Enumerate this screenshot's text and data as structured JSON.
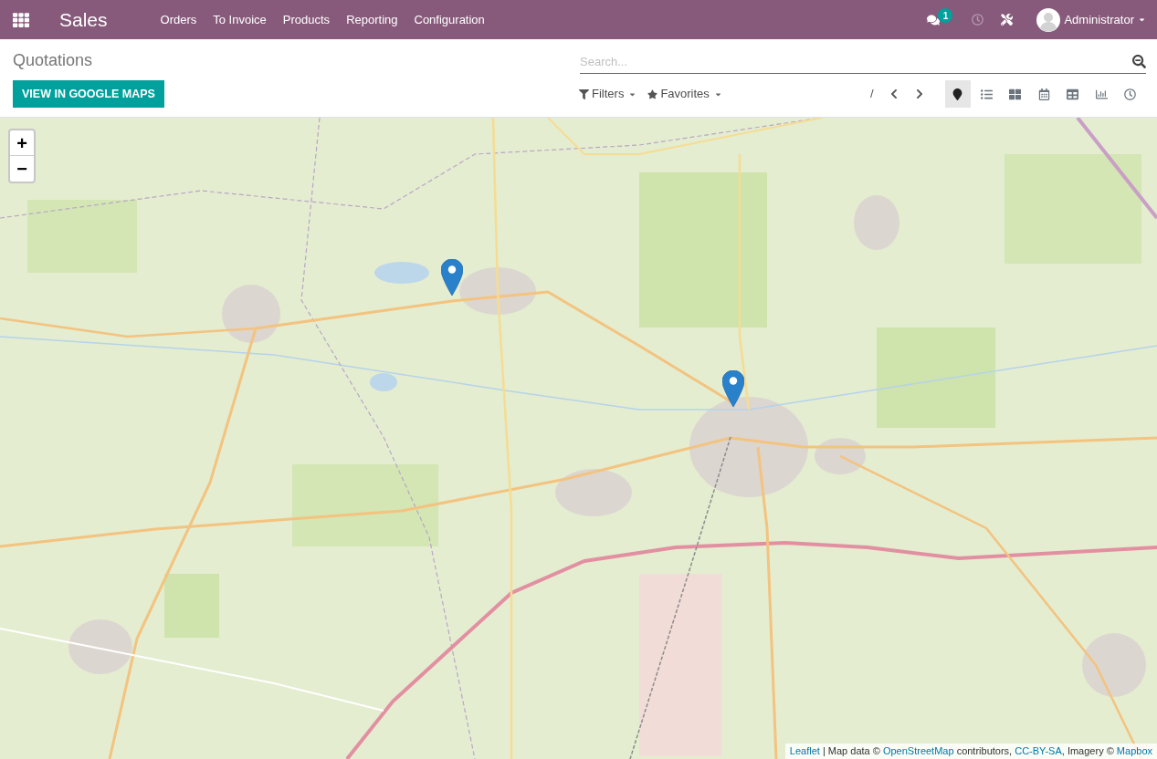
{
  "navbar": {
    "app_name": "Sales",
    "menu": [
      "Orders",
      "To Invoice",
      "Products",
      "Reporting",
      "Configuration"
    ],
    "messages_badge": "1",
    "user": "Administrator"
  },
  "control_panel": {
    "breadcrumb": "Quotations",
    "action_button": "VIEW IN GOOGLE MAPS",
    "search": {
      "placeholder": "Search..."
    },
    "filters": [
      {
        "kind": "filter",
        "label": "Filters"
      },
      {
        "kind": "favorites",
        "label": "Favorites"
      }
    ],
    "pager": "/",
    "views": [
      {
        "kind": "map",
        "selected": true
      },
      {
        "kind": "list",
        "selected": false
      },
      {
        "kind": "kanban",
        "selected": false
      },
      {
        "kind": "calendar",
        "selected": false
      },
      {
        "kind": "pivot",
        "selected": false
      },
      {
        "kind": "graph",
        "selected": false
      },
      {
        "kind": "activity",
        "selected": false
      }
    ]
  },
  "map": {
    "zoom_controls": [
      "+",
      "−"
    ],
    "attribution": [
      {
        "kind": "link",
        "text": "Leaflet"
      },
      {
        "kind": "text",
        "text": " | Map data © "
      },
      {
        "kind": "link",
        "text": "OpenStreetMap"
      },
      {
        "kind": "text",
        "text": " contributors, "
      },
      {
        "kind": "link",
        "text": "CC-BY-SA"
      },
      {
        "kind": "text",
        "text": ", Imagery © "
      },
      {
        "kind": "link",
        "text": "Mapbox"
      }
    ]
  }
}
